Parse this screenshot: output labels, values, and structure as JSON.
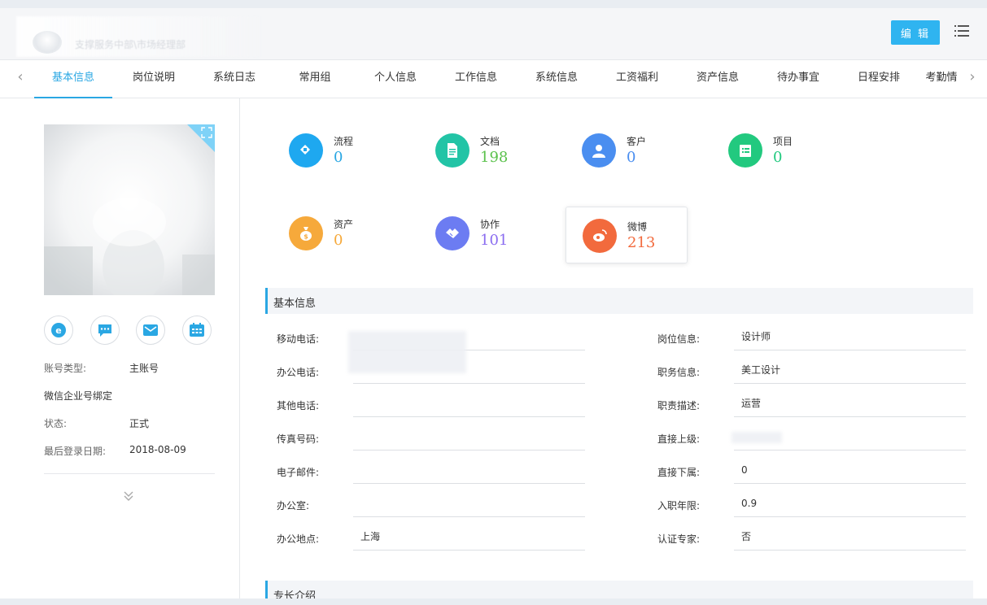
{
  "header": {
    "subtitle": "支撑服务中部\\市场经理部",
    "edit_label": "编 辑",
    "menu_icon": "list-menu-icon"
  },
  "tabs": [
    {
      "label": "基本信息",
      "active": true
    },
    {
      "label": "岗位说明"
    },
    {
      "label": "系统日志"
    },
    {
      "label": "常用组"
    },
    {
      "label": "个人信息"
    },
    {
      "label": "工作信息"
    },
    {
      "label": "系统信息"
    },
    {
      "label": "工资福利"
    },
    {
      "label": "资产信息"
    },
    {
      "label": "待办事宜"
    },
    {
      "label": "日程安排"
    },
    {
      "label": "考勤情"
    }
  ],
  "profile": {
    "contact_icons": [
      "ie-icon",
      "chat-icon",
      "mail-icon",
      "calendar-icon"
    ],
    "info": [
      {
        "label": "账号类型:",
        "value": "主账号"
      },
      {
        "label": "微信企业号绑定",
        "value": ""
      },
      {
        "label": "状态:",
        "value": "正式"
      },
      {
        "label": "最后登录日期:",
        "value": "2018-08-09"
      }
    ]
  },
  "stats": [
    {
      "label": "流程",
      "value": "0",
      "color": "#1ea8f0",
      "value_color": "#2aa7e3",
      "icon": "flow-icon"
    },
    {
      "label": "文档",
      "value": "198",
      "color": "#22c4a6",
      "value_color": "#5ac14b",
      "icon": "document-icon"
    },
    {
      "label": "客户",
      "value": "0",
      "color": "#4a8ef0",
      "value_color": "#4a8ef0",
      "icon": "customer-icon"
    },
    {
      "label": "项目",
      "value": "0",
      "color": "#22c97f",
      "value_color": "#22c97f",
      "icon": "project-icon"
    },
    {
      "label": "资产",
      "value": "0",
      "color": "#f6a93b",
      "value_color": "#f6a93b",
      "icon": "money-bag-icon"
    },
    {
      "label": "协作",
      "value": "101",
      "color": "#6c7cf2",
      "value_color": "#8a6cf0",
      "icon": "handshake-icon"
    },
    {
      "label": "微博",
      "value": "213",
      "color": "#f26a3d",
      "value_color": "#f26a3d",
      "icon": "weibo-icon"
    }
  ],
  "basic_info": {
    "title": "基本信息",
    "left_fields": [
      {
        "label": "移动电话:",
        "value": ""
      },
      {
        "label": "办公电话:",
        "value": ""
      },
      {
        "label": "其他电话:",
        "value": ""
      },
      {
        "label": "传真号码:",
        "value": ""
      },
      {
        "label": "电子邮件:",
        "value": ""
      },
      {
        "label": "办公室:",
        "value": ""
      },
      {
        "label": "办公地点:",
        "value": "上海"
      }
    ],
    "right_fields": [
      {
        "label": "岗位信息:",
        "value": "设计师"
      },
      {
        "label": "职务信息:",
        "value": "美工设计"
      },
      {
        "label": "职责描述:",
        "value": "运营"
      },
      {
        "label": "直接上级:",
        "value": ""
      },
      {
        "label": "直接下属:",
        "value": "0"
      },
      {
        "label": "入职年限:",
        "value": "0.9"
      },
      {
        "label": "认证专家:",
        "value": "否"
      }
    ]
  },
  "expertise": {
    "title": "专长介绍"
  }
}
